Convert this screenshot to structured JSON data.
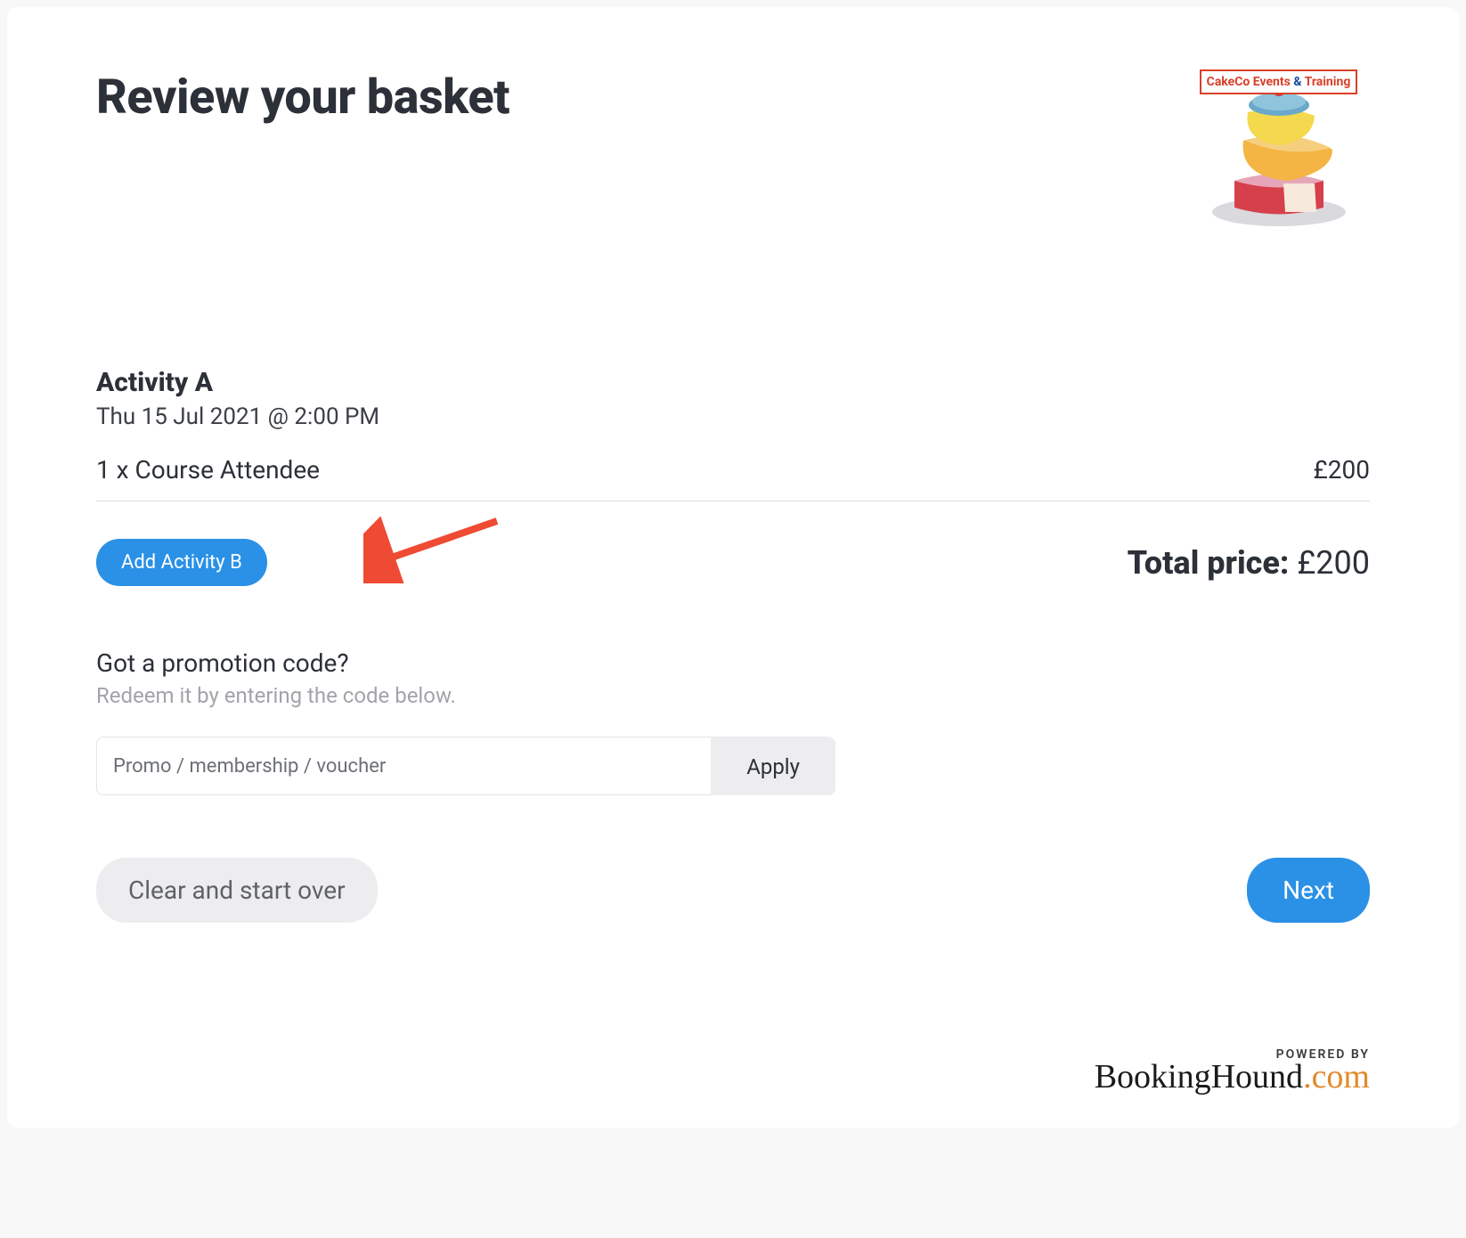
{
  "header": {
    "title": "Review your basket",
    "logo_text_a": "CakeCo Events",
    "logo_text_amp": "&",
    "logo_text_b": "Training"
  },
  "basket": {
    "activity_name": "Activity A",
    "activity_datetime": "Thu 15 Jul 2021 @ 2:00 PM",
    "line_item_label": "1 x Course Attendee",
    "line_item_price": "£200",
    "add_activity_label": "Add Activity B",
    "total_label": "Total price:",
    "total_value": "£200"
  },
  "promo": {
    "heading": "Got a promotion code?",
    "subtext": "Redeem it by entering the code below.",
    "placeholder": "Promo / membership / voucher",
    "apply_label": "Apply"
  },
  "footer": {
    "clear_label": "Clear and start over",
    "next_label": "Next",
    "powered_by": "POWERED BY",
    "brand_main": "BookingHound",
    "brand_suffix": ".com"
  }
}
